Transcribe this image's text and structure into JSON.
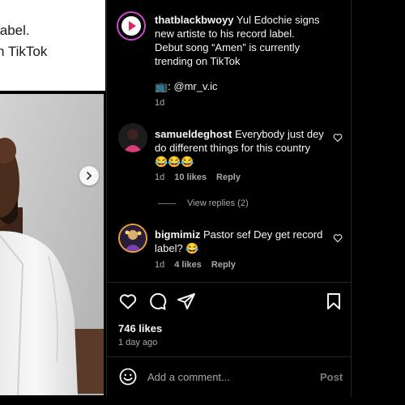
{
  "left": {
    "caption_line1": "label.",
    "caption_line2": "n TikTok"
  },
  "post": {
    "author": "thatblackbwoyy",
    "caption_l1": " Yul Edochie signs",
    "caption_l2": "new artiste to his record label.",
    "caption_l3": "Debut song “Amen” is currently",
    "caption_l4": "trending on TikTok",
    "credit": "📺: @mr_v.ic",
    "age": "1d"
  },
  "comments": [
    {
      "user": "samueldeghost",
      "text_l1": " Everybody just dey",
      "text_l2": "do different things for this country",
      "text_l3": "😂😂😂",
      "age": "1d",
      "likes": "10 likes",
      "reply": "Reply",
      "view_replies": "View replies (2)"
    },
    {
      "user": "bigmimiz",
      "text_l1": " Pastor sef Dey get record",
      "text_l2": "label? 😂",
      "age": "1d",
      "likes": "4 likes",
      "reply": "Reply"
    }
  ],
  "actions": {
    "likes": "746 likes",
    "date": "1 day ago"
  },
  "composer": {
    "placeholder": "Add a comment...",
    "post": "Post"
  },
  "colors": {
    "bg": "#000000",
    "muted": "#a8a8a8",
    "text": "#f5f5f5",
    "divider": "#262626"
  }
}
